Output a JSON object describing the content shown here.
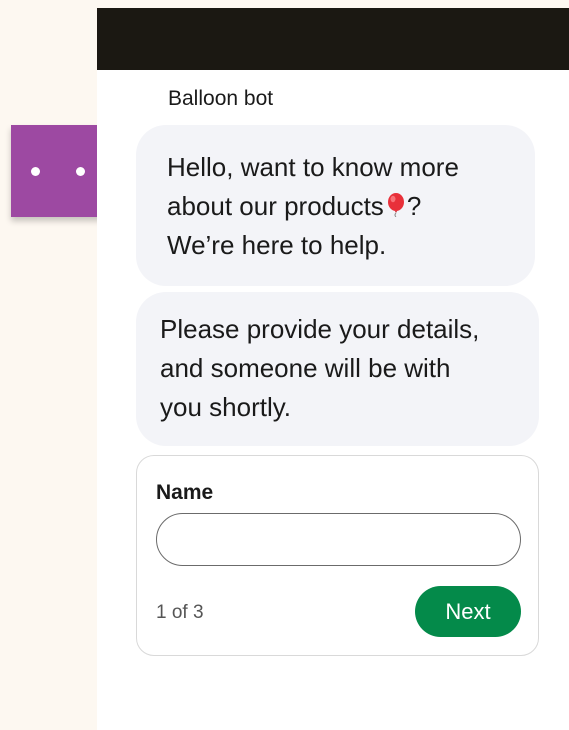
{
  "chat": {
    "bot_name": "Balloon bot",
    "messages": [
      {
        "lines": [
          "Hello, want to know more",
          "about our products",
          "We’re here to help."
        ],
        "line2_suffix": "?",
        "emoji": "balloon-icon"
      },
      {
        "lines": [
          "Please provide your details,",
          "and someone will be with",
          "you shortly."
        ]
      }
    ]
  },
  "form": {
    "field_label": "Name",
    "name_value": "",
    "name_placeholder": "",
    "step": "1 of 3",
    "next_label": "Next"
  },
  "colors": {
    "header": "#1b1812",
    "avatar": "#9d49a2",
    "bubble": "#f3f4f8",
    "next_button": "#048a4a",
    "page_background": "#fdf8f1"
  }
}
